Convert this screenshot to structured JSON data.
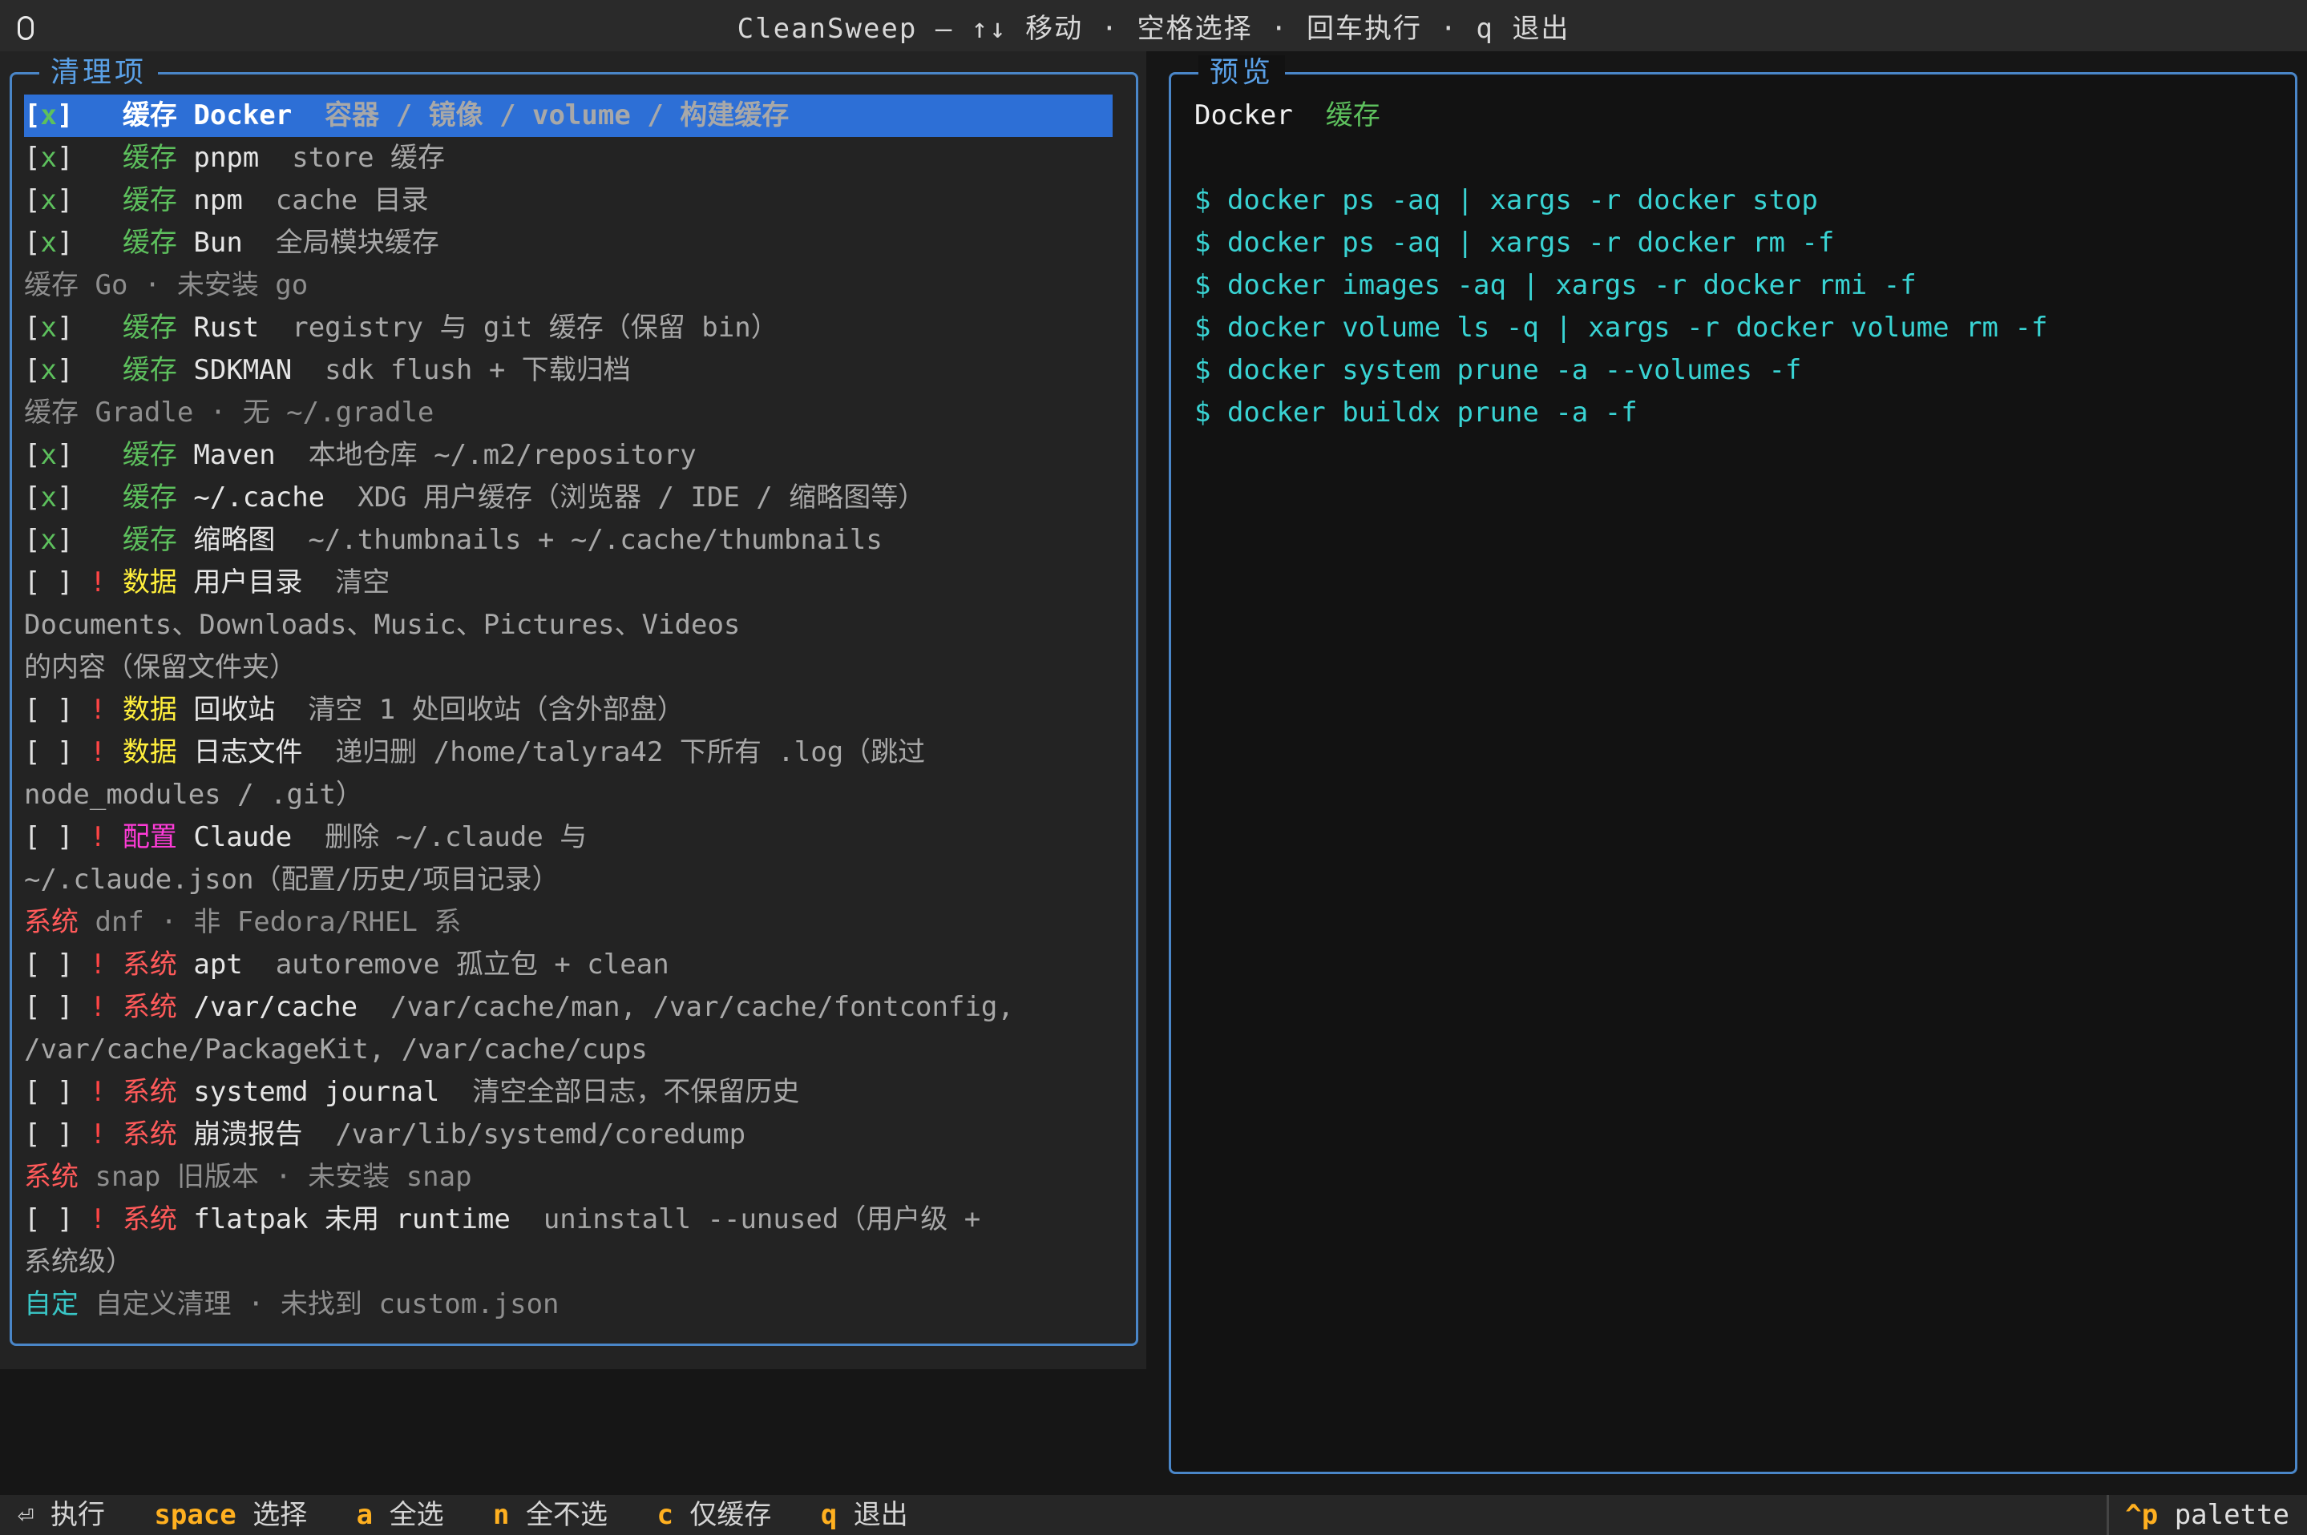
{
  "titlebar": {
    "title": "CleanSweep — ↑↓ 移动 · 空格选择 · 回车执行 · q 退出"
  },
  "left_panel": {
    "title": "清理项",
    "items": [
      {
        "check": "[x]",
        "warn": "",
        "category": "缓存",
        "cat_class": "tag-cache",
        "name": "Docker",
        "desc": "容器 / 镜像 / volume / 构建缓存",
        "selected": true
      },
      {
        "check": "[x]",
        "warn": "",
        "category": "缓存",
        "cat_class": "tag-cache",
        "name": "pnpm",
        "desc": "store 缓存"
      },
      {
        "check": "[x]",
        "warn": "",
        "category": "缓存",
        "cat_class": "tag-cache",
        "name": "npm",
        "desc": "cache 目录"
      },
      {
        "check": "[x]",
        "warn": "",
        "category": "缓存",
        "cat_class": "tag-cache",
        "name": "Bun",
        "desc": "全局模块缓存"
      },
      {
        "plain": "缓存 Go · 未安装 go",
        "plain_class": "dim"
      },
      {
        "check": "[x]",
        "warn": "",
        "category": "缓存",
        "cat_class": "tag-cache",
        "name": "Rust",
        "desc": "registry 与 git 缓存（保留 bin）"
      },
      {
        "check": "[x]",
        "warn": "",
        "category": "缓存",
        "cat_class": "tag-cache",
        "name": "SDKMAN",
        "desc": "sdk flush + 下载归档"
      },
      {
        "plain": "缓存 Gradle · 无 ~/.gradle",
        "plain_class": "dim"
      },
      {
        "check": "[x]",
        "warn": "",
        "category": "缓存",
        "cat_class": "tag-cache",
        "name": "Maven",
        "desc": "本地仓库 ~/.m2/repository"
      },
      {
        "check": "[x]",
        "warn": "",
        "category": "缓存",
        "cat_class": "tag-cache",
        "name": "~/.cache",
        "desc": "XDG 用户缓存（浏览器 / IDE / 缩略图等）"
      },
      {
        "check": "[x]",
        "warn": "",
        "category": "缓存",
        "cat_class": "tag-cache",
        "name": "缩略图",
        "desc": "~/.thumbnails + ~/.cache/thumbnails"
      },
      {
        "check": "[ ]",
        "warn": "!",
        "category": "数据",
        "cat_class": "tag-data",
        "name": "用户目录",
        "desc": "清空"
      },
      {
        "plain": "Documents、Downloads、Music、Pictures、Videos",
        "plain_class": "desc"
      },
      {
        "plain": "的内容（保留文件夹）",
        "plain_class": "desc"
      },
      {
        "check": "[ ]",
        "warn": "!",
        "category": "数据",
        "cat_class": "tag-data",
        "name": "回收站",
        "desc": "清空 1 处回收站（含外部盘）"
      },
      {
        "check": "[ ]",
        "warn": "!",
        "category": "数据",
        "cat_class": "tag-data",
        "name": "日志文件",
        "desc": "递归删 /home/talyra42 下所有 .log（跳过"
      },
      {
        "plain": "node_modules / .git）",
        "plain_class": "desc"
      },
      {
        "check": "[ ]",
        "warn": "!",
        "category": "配置",
        "cat_class": "tag-config",
        "name": "Claude",
        "desc": "删除 ~/.claude 与"
      },
      {
        "plain": "~/.claude.json（配置/历史/项目记录）",
        "plain_class": "desc"
      },
      {
        "plain_tag": "系统",
        "plain_tag_class": "tag-system",
        "plain": " dnf · 非 Fedora/RHEL 系",
        "plain_class": "dim"
      },
      {
        "check": "[ ]",
        "warn": "!",
        "category": "系统",
        "cat_class": "tag-system",
        "name": "apt",
        "desc": "autoremove 孤立包 + clean"
      },
      {
        "check": "[ ]",
        "warn": "!",
        "category": "系统",
        "cat_class": "tag-system",
        "name": "/var/cache",
        "desc": "/var/cache/man, /var/cache/fontconfig,"
      },
      {
        "plain": "/var/cache/PackageKit, /var/cache/cups",
        "plain_class": "desc"
      },
      {
        "check": "[ ]",
        "warn": "!",
        "category": "系统",
        "cat_class": "tag-system",
        "name": "systemd journal",
        "desc": "清空全部日志，不保留历史"
      },
      {
        "check": "[ ]",
        "warn": "!",
        "category": "系统",
        "cat_class": "tag-system",
        "name": "崩溃报告",
        "desc": "/var/lib/systemd/coredump"
      },
      {
        "plain_tag": "系统",
        "plain_tag_class": "tag-system",
        "plain": " snap 旧版本 · 未安装 snap",
        "plain_class": "dim"
      },
      {
        "check": "[ ]",
        "warn": "!",
        "category": "系统",
        "cat_class": "tag-system",
        "name": "flatpak 未用 runtime",
        "desc": "uninstall --unused（用户级 +"
      },
      {
        "plain": "系统级）",
        "plain_class": "desc"
      },
      {
        "plain_tag": "自定",
        "plain_tag_class": "tag-custom",
        "plain": " 自定义清理 · 未找到 custom.json",
        "plain_class": "dim"
      }
    ]
  },
  "right_panel": {
    "title": "预览",
    "head_name": "Docker",
    "head_tag": "缓存",
    "commands": [
      "$ docker ps -aq | xargs -r docker stop",
      "$ docker ps -aq | xargs -r docker rm -f",
      "$ docker images -aq | xargs -r docker rmi -f",
      "$ docker volume ls -q | xargs -r docker volume rm -f",
      "$ docker system prune -a --volumes -f",
      "$ docker buildx prune -a -f"
    ]
  },
  "statusbar": {
    "enter_icon": "⏎",
    "items": [
      {
        "key": "",
        "label": "执行"
      },
      {
        "key": "space",
        "label": "选择"
      },
      {
        "key": "a",
        "label": "全选"
      },
      {
        "key": "n",
        "label": "全不选"
      },
      {
        "key": "c",
        "label": "仅缓存"
      },
      {
        "key": "q",
        "label": "退出"
      }
    ],
    "right_key": "^p",
    "right_label": "palette"
  }
}
